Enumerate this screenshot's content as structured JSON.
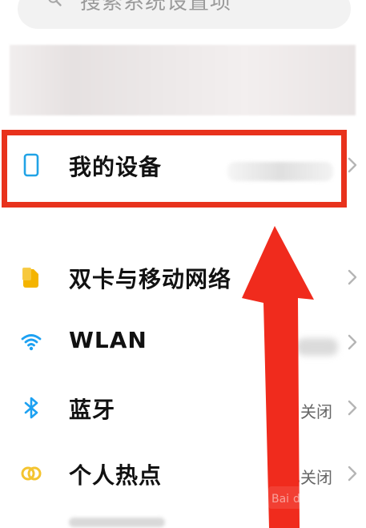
{
  "search": {
    "placeholder": "搜索系统设置项",
    "icon": "search-icon"
  },
  "settings": {
    "items": [
      {
        "label": "我的设备",
        "icon": "phone-icon",
        "value": ""
      },
      {
        "label": "双卡与移动网络",
        "icon": "sim-card-icon",
        "value": ""
      },
      {
        "label": "WLAN",
        "icon": "wifi-icon",
        "value": ""
      },
      {
        "label": "蓝牙",
        "icon": "bluetooth-icon",
        "value": "关闭"
      },
      {
        "label": "个人热点",
        "icon": "hotspot-icon",
        "value": "已关闭"
      }
    ]
  },
  "colors": {
    "highlight": "#e8321c",
    "accent": "#1da1f2",
    "sim": "#f4b400",
    "hotspot": "#f4c430"
  }
}
